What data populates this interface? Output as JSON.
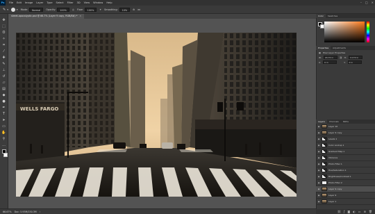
{
  "menubar": {
    "logo": "Ps",
    "items": [
      "File",
      "Edit",
      "Image",
      "Layer",
      "Type",
      "Select",
      "Filter",
      "3D",
      "View",
      "Window",
      "Help"
    ]
  },
  "options": {
    "mode_label": "Mode:",
    "mode_value": "Normal",
    "opacity_label": "Opacity:",
    "opacity_value": "100%",
    "flow_label": "Flow:",
    "flow_value": "100%",
    "smoothing_label": "Smoothing:",
    "smoothing_value": "10%"
  },
  "document": {
    "tab_title": "street-apocalyptic.psd @ 66.7% (Layer 9 copy, RGB/8#) *",
    "close_glyph": "×"
  },
  "statusbar": {
    "zoom": "66.67%",
    "doc_info": "Doc: 5.93M/150.3M"
  },
  "color_panel": {
    "tabs": [
      "Color",
      "Swatches"
    ],
    "fg_color": "#000000",
    "bg_color": "#ffffff"
  },
  "properties_panel": {
    "tabs": [
      "Properties",
      "Adjustments"
    ],
    "title": "Pixel Layer Properties",
    "w_label": "W:",
    "w_value": "24.72 in",
    "h_label": "H:",
    "h_value": "14.72 in",
    "x_label": "X:",
    "x_value": "0 in",
    "y_label": "Y:",
    "y_value": "0 in"
  },
  "layers_panel": {
    "tabs": [
      "Layers",
      "Channels",
      "Paths"
    ],
    "layers": [
      {
        "name": "Layer 10",
        "thumb": "photo",
        "visible": true,
        "selected": false
      },
      {
        "name": "Layer 9 copy",
        "thumb": "photo",
        "visible": true,
        "selected": false
      },
      {
        "name": "Levels 1",
        "thumb": "adj",
        "visible": true,
        "selected": false
      },
      {
        "name": "Color Lookup 1",
        "thumb": "adj",
        "visible": true,
        "selected": false
      },
      {
        "name": "Gradient Map 1",
        "thumb": "adj",
        "visible": true,
        "selected": false
      },
      {
        "name": "Vibrance",
        "thumb": "adj",
        "visible": true,
        "selected": false
      },
      {
        "name": "Photo Filter 1",
        "thumb": "adj",
        "visible": true,
        "selected": false
      },
      {
        "name": "Hue/Saturation 1",
        "thumb": "adj",
        "visible": true,
        "selected": false
      },
      {
        "name": "Brightness/Contrast 1",
        "thumb": "adj",
        "visible": true,
        "selected": false
      },
      {
        "name": "Photo Filter 2",
        "thumb": "mask",
        "visible": true,
        "selected": false
      },
      {
        "name": "Layer 9 copy",
        "thumb": "photo",
        "visible": true,
        "selected": true
      },
      {
        "name": "Layer 9",
        "thumb": "photo",
        "visible": true,
        "selected": false
      },
      {
        "name": "Layer 1",
        "thumb": "photo",
        "visible": true,
        "selected": false
      }
    ],
    "footer_icons": [
      "link-icon",
      "fx-icon",
      "mask-icon",
      "adjustment-icon",
      "folder-icon",
      "new-layer-icon",
      "trash-icon"
    ]
  },
  "toolbar": {
    "tools": [
      "move-tool-icon",
      "marquee-tool-icon",
      "lasso-tool-icon",
      "quick-select-tool-icon",
      "crop-tool-icon",
      "eyedropper-tool-icon",
      "healing-tool-icon",
      "brush-tool-icon",
      "clone-tool-icon",
      "history-brush-icon",
      "eraser-tool-icon",
      "gradient-tool-icon",
      "blur-tool-icon",
      "dodge-tool-icon",
      "pen-tool-icon",
      "type-tool-icon",
      "path-select-icon",
      "shape-tool-icon",
      "hand-tool-icon",
      "zoom-tool-icon"
    ]
  },
  "photo": {
    "signage": "WELLS FARGO",
    "sky_color": "#e6c69a",
    "shadow_color": "#1c1a18"
  }
}
